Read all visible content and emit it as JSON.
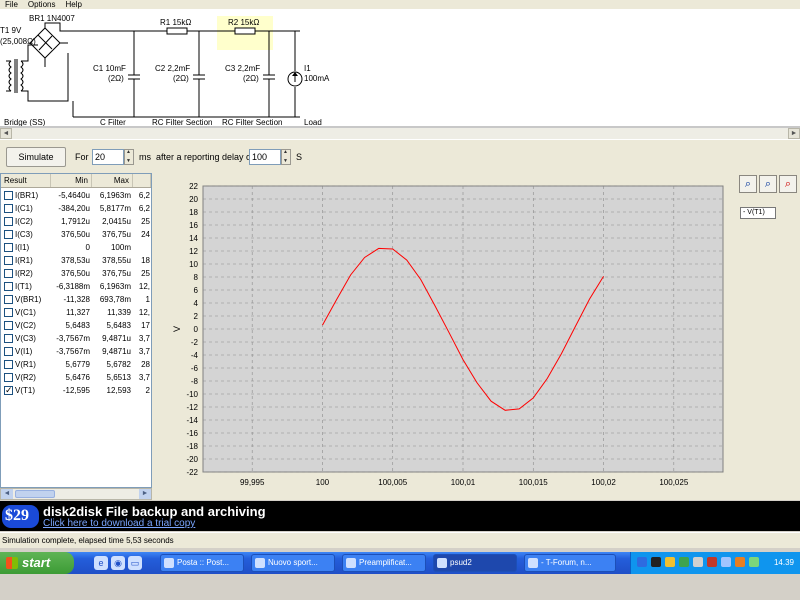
{
  "menu": [
    "File",
    "Options",
    "Help"
  ],
  "schematic": {
    "bridge_name": "BR1 1N4007",
    "transformer": "T1 9V",
    "transformer_res": "(25,008Ω)",
    "r1": "R1 15kΩ",
    "r2": "R2 15kΩ",
    "c1": "C1 10mF",
    "c1_res": "(2Ω)",
    "c2": "C2 2,2mF",
    "c2_res": "(2Ω)",
    "c3": "C3 2,2mF",
    "c3_res": "(2Ω)",
    "load": "I1",
    "load_val": "100mA",
    "sections": [
      "Bridge (SS)",
      "C Filter",
      "RC Filter Section",
      "RC Filter Section",
      "Load"
    ]
  },
  "toolbar": {
    "simulate": "Simulate",
    "for": "For",
    "duration": "20",
    "ms": "ms",
    "after": "after a reporting delay of",
    "delay": "100",
    "s": "S"
  },
  "results": {
    "columns": [
      "Result",
      "Min",
      "Max",
      ""
    ],
    "rows": [
      {
        "name": "I(BR1)",
        "min": "-5,4640u",
        "max": "6,1963m",
        "rms": "6,2",
        "checked": false
      },
      {
        "name": "I(C1)",
        "min": "-384,20u",
        "max": "5,8177m",
        "rms": "6,2",
        "checked": false
      },
      {
        "name": "I(C2)",
        "min": "1,7912u",
        "max": "2,0415u",
        "rms": "25",
        "checked": false
      },
      {
        "name": "I(C3)",
        "min": "376,50u",
        "max": "376,75u",
        "rms": "24",
        "checked": false
      },
      {
        "name": "I(I1)",
        "min": "0",
        "max": "100m",
        "rms": "",
        "checked": false
      },
      {
        "name": "I(R1)",
        "min": "378,53u",
        "max": "378,55u",
        "rms": "18",
        "checked": false
      },
      {
        "name": "I(R2)",
        "min": "376,50u",
        "max": "376,75u",
        "rms": "25",
        "checked": false
      },
      {
        "name": "I(T1)",
        "min": "-6,3188m",
        "max": "6,1963m",
        "rms": "12,",
        "checked": false
      },
      {
        "name": "V(BR1)",
        "min": "-11,328",
        "max": "693,78m",
        "rms": "1",
        "checked": false
      },
      {
        "name": "V(C1)",
        "min": "11,327",
        "max": "11,339",
        "rms": "12,",
        "checked": false
      },
      {
        "name": "V(C2)",
        "min": "5,6483",
        "max": "5,6483",
        "rms": "17",
        "checked": false
      },
      {
        "name": "V(C3)",
        "min": "-3,7567m",
        "max": "9,4871u",
        "rms": "3,7",
        "checked": false
      },
      {
        "name": "V(I1)",
        "min": "-3,7567m",
        "max": "9,4871u",
        "rms": "3,7",
        "checked": false
      },
      {
        "name": "V(R1)",
        "min": "5,6779",
        "max": "5,6782",
        "rms": "28",
        "checked": false
      },
      {
        "name": "V(R2)",
        "min": "5,6476",
        "max": "5,6513",
        "rms": "3,7",
        "checked": false
      },
      {
        "name": "V(T1)",
        "min": "-12,595",
        "max": "12,593",
        "rms": "2",
        "checked": true
      }
    ]
  },
  "plot": {
    "legend": "- V(T1)",
    "zoom_icons": [
      "zoom-fit-icon",
      "zoom-in-icon",
      "zoom-out-icon"
    ]
  },
  "chart_data": {
    "type": "line",
    "ylabel": "V",
    "xlim": [
      99.9915,
      100.0285
    ],
    "ylim": [
      -22,
      22
    ],
    "xticks": [
      99.995,
      100,
      100.005,
      100.01,
      100.015,
      100.02,
      100.025
    ],
    "xtick_labels": [
      "99,995",
      "100",
      "100,005",
      "100,01",
      "100,015",
      "100,02",
      "100,025"
    ],
    "yticks": [
      22,
      20,
      18,
      16,
      14,
      12,
      10,
      8,
      6,
      4,
      2,
      0,
      -2,
      -4,
      -6,
      -8,
      -10,
      -12,
      -14,
      -16,
      -18,
      -20,
      -22
    ],
    "grid": true,
    "series": [
      {
        "name": "V(T1)",
        "color": "#ff0000",
        "x": [
          100.0,
          100.001,
          100.002,
          100.003,
          100.004,
          100.005,
          100.006,
          100.007,
          100.008,
          100.009,
          100.01,
          100.011,
          100.012,
          100.013,
          100.014,
          100.015,
          100.016,
          100.017,
          100.018,
          100.019,
          100.02
        ],
        "y": [
          0.6,
          4.5,
          8.3,
          11.0,
          12.4,
          12.3,
          10.6,
          7.6,
          3.6,
          -0.5,
          -4.7,
          -8.3,
          -11.1,
          -12.5,
          -12.3,
          -10.6,
          -7.6,
          -3.8,
          0.4,
          4.6,
          8.1
        ]
      }
    ]
  },
  "ad": {
    "price": "$29",
    "headline": "disk2disk File backup and archiving",
    "link": "Click here to download a trial copy"
  },
  "status": "Simulation complete, elapsed time 5,53 seconds",
  "taskbar": {
    "start": "start",
    "tasks": [
      "Posta :: Post...",
      "Nuovo sport...",
      "Preamplificat...",
      "psud2",
      "- T-Forum, n..."
    ],
    "clock": "14.39"
  }
}
